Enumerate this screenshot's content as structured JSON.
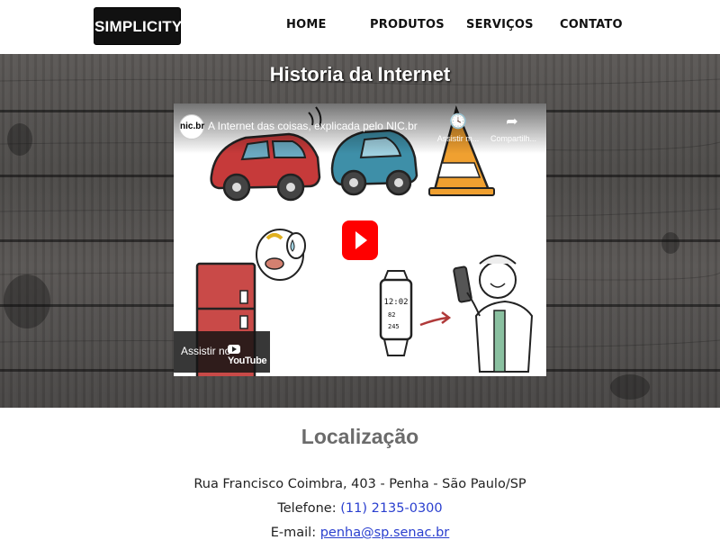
{
  "header": {
    "logo": "SIMPLICITY",
    "nav": [
      "HOME",
      "PRODUTOS",
      "SERVIÇOS",
      "CONTATO"
    ]
  },
  "hero": {
    "title": "Historia da Internet"
  },
  "video": {
    "channel_badge": "nic.br",
    "title": "A Internet das coisas, explicada pelo NIC.br",
    "watch_later": "Assistir m...",
    "share": "Compartilh...",
    "watch_on": "Assistir no",
    "youtube": "YouTube",
    "watch_display": [
      "12:02",
      "82",
      "245"
    ]
  },
  "location": {
    "title": "Localização",
    "address": "Rua Francisco Coimbra, 403 - Penha - São Paulo/SP",
    "phone_label": "Telefone:",
    "phone": "(11) 2135-0300",
    "email_label": "E-mail:",
    "email": "penha@sp.senac.br"
  },
  "colors": {
    "youtube_red": "#ff0000",
    "link": "#2a3fcf",
    "car_red": "#c63a3a",
    "car_blue": "#3e8fa8",
    "cone": "#f0a030"
  }
}
